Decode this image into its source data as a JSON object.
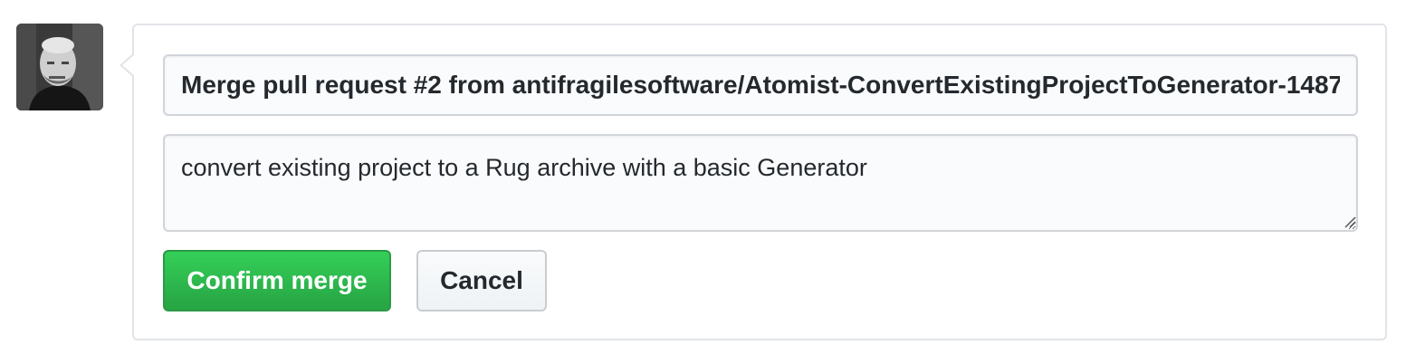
{
  "avatar": {
    "alt": "user avatar",
    "icon": "avatar-photo"
  },
  "merge_form": {
    "commit_title": "Merge pull request #2 from antifragilesoftware/Atomist-ConvertExistingProjectToGenerator-1487",
    "commit_body": "convert existing project to a Rug archive with a basic Generator",
    "confirm_label": "Confirm merge",
    "cancel_label": "Cancel"
  },
  "colors": {
    "confirm_button": "#28a745",
    "border": "#e1e4e8",
    "input_background": "#fafbfc"
  }
}
